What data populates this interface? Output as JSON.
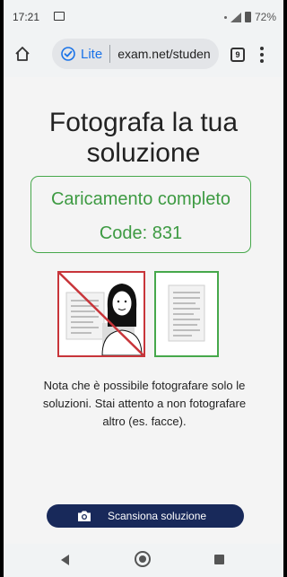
{
  "status_bar": {
    "time": "17:21",
    "battery": "72%"
  },
  "browser": {
    "mode_label": "Lite",
    "url": "exam.net/studen",
    "tab_count": "9"
  },
  "page": {
    "title": "Fotografa la tua soluzione",
    "upload_status": "Caricamento completo",
    "code": "Code: 831",
    "note": "Nota che è possibile fotografare solo le soluzioni. Stai attento a non fotografare altro (es. facce).",
    "scan_button_label": "Scansiona soluzione"
  },
  "colors": {
    "success": "#3d9a42",
    "error": "#c8353a",
    "button": "#18295a",
    "accent": "#1a73e8"
  },
  "icons": {
    "home": "home-icon",
    "lite": "lite-mode-icon",
    "camera": "camera-icon",
    "back": "back-icon",
    "nav_home": "nav-home-icon",
    "recents": "recents-icon"
  }
}
